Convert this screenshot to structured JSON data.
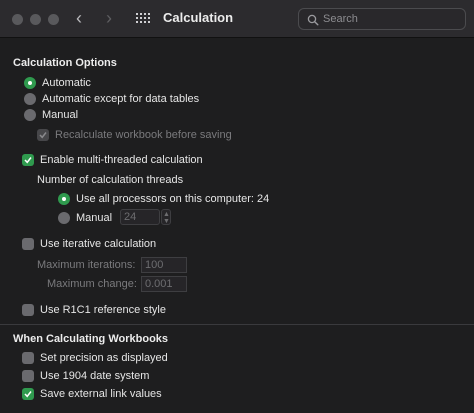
{
  "window": {
    "title": "Calculation",
    "search_placeholder": "Search"
  },
  "calculation_options": {
    "heading": "Calculation Options",
    "automatic": "Automatic",
    "automatic_except": "Automatic except for data tables",
    "manual": "Manual",
    "recalculate": "Recalculate workbook before saving",
    "multi_threaded": "Enable multi-threaded calculation",
    "threads_label": "Number of calculation threads",
    "use_all": "Use all processors on this computer: 24",
    "manual_threads": "Manual",
    "manual_threads_value": "24",
    "iterative": "Use iterative calculation",
    "max_iterations_label": "Maximum iterations:",
    "max_iterations_value": "100",
    "max_change_label": "Maximum change:",
    "max_change_value": "0.001",
    "r1c1": "Use R1C1 reference style"
  },
  "when_calculating": {
    "heading": "When Calculating Workbooks",
    "precision": "Set precision as displayed",
    "date_1904": "Use 1904 date system",
    "external_links": "Save external link values"
  },
  "colors": {
    "accent": "#2f9a4e",
    "background": "#1e1e1f",
    "titlebar": "#2c2b2e"
  }
}
